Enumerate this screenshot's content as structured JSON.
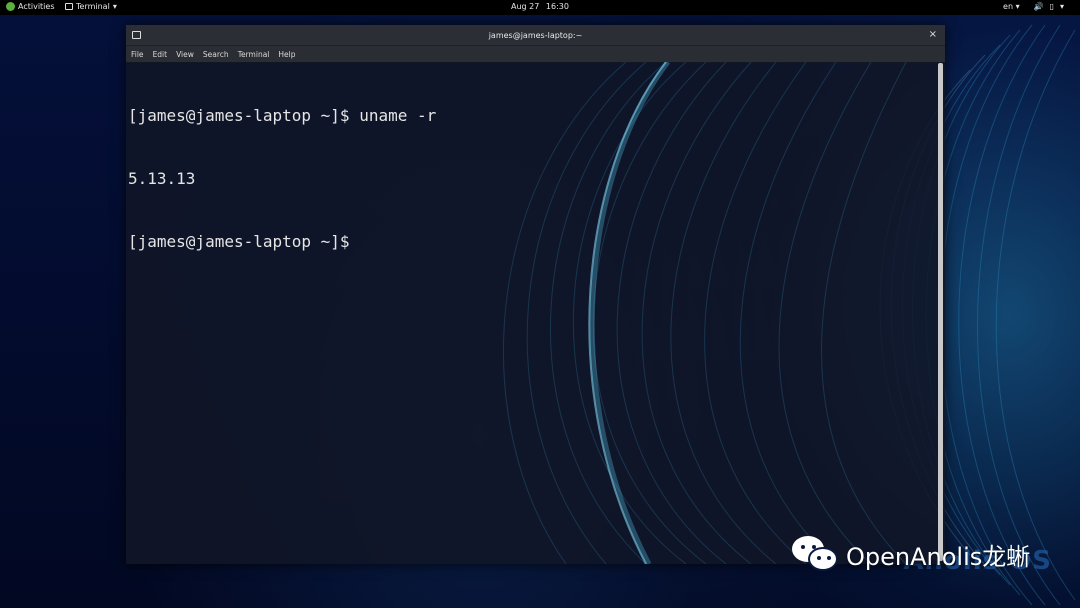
{
  "topbar": {
    "activities": "Activities",
    "app_menu": "Terminal",
    "clock_date": "Aug 27",
    "clock_time": "16:30",
    "lang": "en",
    "sound_icon": "speaker-icon",
    "power_icon": "battery-icon"
  },
  "window": {
    "title": "james@james-laptop:~",
    "close_glyph": "×",
    "menu": [
      "File",
      "Edit",
      "View",
      "Search",
      "Terminal",
      "Help"
    ]
  },
  "terminal": {
    "lines": [
      "[james@james-laptop ~]$ uname -r",
      "5.13.13",
      "[james@james-laptop ~]$"
    ]
  },
  "wallpaper": {
    "brand": "Anolis OS"
  },
  "watermark": {
    "text": "OpenAnolis龙蜥",
    "icon": "wechat-icon"
  },
  "colors": {
    "topbar": "#000000",
    "titlebar": "#2b2e34",
    "terminal_bg": "#111626",
    "wallpaper_glow": "#1e78aa"
  }
}
